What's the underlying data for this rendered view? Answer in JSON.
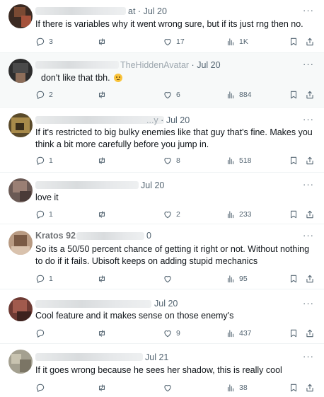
{
  "tweets": [
    {
      "name_fragment": "at",
      "date": "Jul 20",
      "text": "If there is variables why it went wrong sure, but if its just rng then no.",
      "replies": "3",
      "reposts": "",
      "likes": "17",
      "views": "1K"
    },
    {
      "name_fragment": "TheHiddenAvatar",
      "date": "Jul 20",
      "text": "don't like that tbh.",
      "replies": "2",
      "reposts": "",
      "likes": "6",
      "views": "884"
    },
    {
      "name_fragment": "...y",
      "date": "Jul 20",
      "text": "If it's restricted to big bulky enemies like that guy that's fine. Makes you think a bit more carefully before you jump in.",
      "replies": "1",
      "reposts": "",
      "likes": "8",
      "views": "518"
    },
    {
      "name_fragment": "Jul 20",
      "date": "",
      "text": "love it",
      "replies": "1",
      "reposts": "",
      "likes": "2",
      "views": "233"
    },
    {
      "name_fragment": "Kratos 92",
      "date": "0",
      "text": "So its a 50/50 percent chance of getting it right or not. Without nothing to do if it fails. Ubisoft keeps on adding stupid mechanics",
      "replies": "1",
      "reposts": "",
      "likes": "",
      "views": "95"
    },
    {
      "name_fragment": "",
      "date": "Jul 20",
      "text": "Cool feature and it makes sense on those enemy's",
      "replies": "",
      "reposts": "",
      "likes": "9",
      "views": "437"
    },
    {
      "name_fragment": "Jul 21",
      "date": "",
      "text": "If it goes wrong because he sees her shadow, this is really cool",
      "replies": "",
      "reposts": "",
      "likes": "",
      "views": "38"
    }
  ],
  "labels": {
    "more": "···",
    "separator": "·"
  },
  "colors": {
    "muted": "#536471",
    "text": "#0f1419",
    "divider": "#eff3f4",
    "shaded_bg": "#f7f9f9"
  }
}
